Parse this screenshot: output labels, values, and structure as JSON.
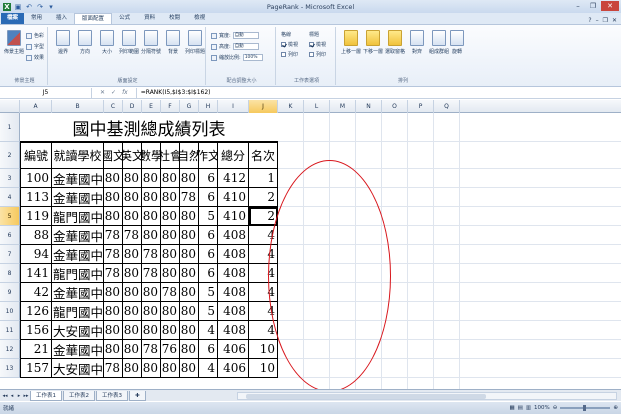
{
  "window": {
    "title": "PageRank - Microsoft Excel",
    "qat": [
      "save-icon",
      "undo-icon",
      "redo-icon"
    ],
    "controls": [
      "minimize",
      "restore",
      "close"
    ]
  },
  "ribbon": {
    "tabs": [
      "檔案",
      "常用",
      "插入",
      "版面配置",
      "公式",
      "資料",
      "校閱",
      "檢視"
    ],
    "active_tab": "版面配置",
    "groups": [
      {
        "label": "佈景主題",
        "buttons": [
          "佈景主題"
        ],
        "small": [
          "色彩",
          "字型",
          "效果"
        ]
      },
      {
        "label": "版面設定",
        "buttons": [
          "邊界",
          "方向",
          "大小",
          "列印範圍",
          "分隔符號",
          "背景",
          "列印標題"
        ]
      },
      {
        "label": "配合調整大小",
        "rows": [
          {
            "label": "寬度:",
            "value": "自動"
          },
          {
            "label": "高度:",
            "value": "自動"
          },
          {
            "label": "縮放比例:",
            "value": "100%"
          }
        ]
      },
      {
        "label": "工作表選項",
        "cols": [
          {
            "title": "格線",
            "view": "檢視",
            "print": "列印"
          },
          {
            "title": "標題",
            "view": "檢視",
            "print": "列印"
          }
        ]
      },
      {
        "label": "排列",
        "buttons": [
          "上移一層",
          "下移一層",
          "選取窗格",
          "對齊",
          "組成群組",
          "旋轉"
        ]
      }
    ]
  },
  "formula_bar": {
    "name_box": "J5",
    "fx": "fx",
    "formula": "=RANK(I5,$I$3:$I$162)"
  },
  "sheet": {
    "columns": [
      "A",
      "B",
      "C",
      "D",
      "E",
      "F",
      "G",
      "H",
      "I",
      "J",
      "K",
      "L",
      "M",
      "N",
      "O",
      "P",
      "Q"
    ],
    "selected_column": "J",
    "selected_row": "5",
    "title": "國中基測總成績列表",
    "headers": [
      "編號",
      "就讀學校",
      "國文",
      "英文",
      "數學",
      "社會",
      "自然",
      "作文",
      "總分",
      "名次"
    ],
    "row_numbers": [
      "1",
      "2",
      "3",
      "4",
      "5",
      "6",
      "7",
      "8",
      "9",
      "10",
      "11",
      "12",
      "13"
    ],
    "rows": [
      [
        "100",
        "金華國中",
        "80",
        "80",
        "80",
        "80",
        "80",
        "6",
        "412",
        "1"
      ],
      [
        "113",
        "金華國中",
        "80",
        "80",
        "80",
        "80",
        "78",
        "6",
        "410",
        "2"
      ],
      [
        "119",
        "龍門國中",
        "80",
        "80",
        "80",
        "80",
        "80",
        "5",
        "410",
        "2"
      ],
      [
        "88",
        "金華國中",
        "78",
        "78",
        "80",
        "80",
        "80",
        "6",
        "408",
        "4"
      ],
      [
        "94",
        "金華國中",
        "78",
        "80",
        "78",
        "80",
        "80",
        "6",
        "408",
        "4"
      ],
      [
        "141",
        "龍門國中",
        "78",
        "80",
        "78",
        "80",
        "80",
        "6",
        "408",
        "4"
      ],
      [
        "42",
        "金華國中",
        "80",
        "80",
        "80",
        "78",
        "80",
        "5",
        "408",
        "4"
      ],
      [
        "126",
        "龍門國中",
        "80",
        "80",
        "80",
        "80",
        "80",
        "5",
        "408",
        "4"
      ],
      [
        "156",
        "大安國中",
        "80",
        "80",
        "80",
        "80",
        "80",
        "4",
        "408",
        "4"
      ],
      [
        "21",
        "金華國中",
        "80",
        "80",
        "78",
        "76",
        "80",
        "6",
        "406",
        "10"
      ],
      [
        "157",
        "大安國中",
        "78",
        "80",
        "80",
        "80",
        "80",
        "4",
        "406",
        "10"
      ]
    ]
  },
  "sheet_tabs": [
    "工作表1",
    "工作表2",
    "工作表3"
  ],
  "active_sheet": "工作表1",
  "status": {
    "mode": "就緒",
    "zoom": "100%"
  },
  "annotation_color": "#d8161c"
}
